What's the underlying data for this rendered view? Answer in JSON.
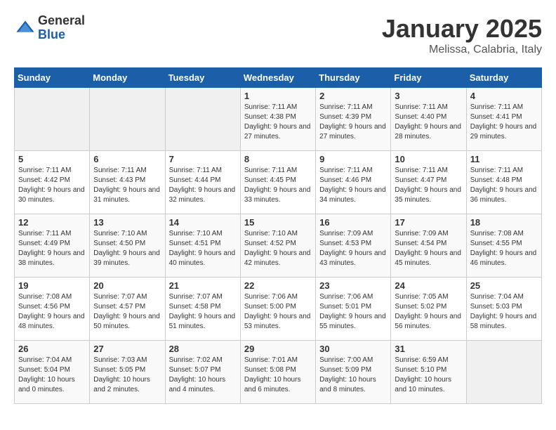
{
  "logo": {
    "general": "General",
    "blue": "Blue"
  },
  "header": {
    "title": "January 2025",
    "subtitle": "Melissa, Calabria, Italy"
  },
  "weekdays": [
    "Sunday",
    "Monday",
    "Tuesday",
    "Wednesday",
    "Thursday",
    "Friday",
    "Saturday"
  ],
  "weeks": [
    [
      {
        "day": "",
        "sunrise": "",
        "sunset": "",
        "daylight": ""
      },
      {
        "day": "",
        "sunrise": "",
        "sunset": "",
        "daylight": ""
      },
      {
        "day": "",
        "sunrise": "",
        "sunset": "",
        "daylight": ""
      },
      {
        "day": "1",
        "sunrise": "Sunrise: 7:11 AM",
        "sunset": "Sunset: 4:38 PM",
        "daylight": "Daylight: 9 hours and 27 minutes."
      },
      {
        "day": "2",
        "sunrise": "Sunrise: 7:11 AM",
        "sunset": "Sunset: 4:39 PM",
        "daylight": "Daylight: 9 hours and 27 minutes."
      },
      {
        "day": "3",
        "sunrise": "Sunrise: 7:11 AM",
        "sunset": "Sunset: 4:40 PM",
        "daylight": "Daylight: 9 hours and 28 minutes."
      },
      {
        "day": "4",
        "sunrise": "Sunrise: 7:11 AM",
        "sunset": "Sunset: 4:41 PM",
        "daylight": "Daylight: 9 hours and 29 minutes."
      }
    ],
    [
      {
        "day": "5",
        "sunrise": "Sunrise: 7:11 AM",
        "sunset": "Sunset: 4:42 PM",
        "daylight": "Daylight: 9 hours and 30 minutes."
      },
      {
        "day": "6",
        "sunrise": "Sunrise: 7:11 AM",
        "sunset": "Sunset: 4:43 PM",
        "daylight": "Daylight: 9 hours and 31 minutes."
      },
      {
        "day": "7",
        "sunrise": "Sunrise: 7:11 AM",
        "sunset": "Sunset: 4:44 PM",
        "daylight": "Daylight: 9 hours and 32 minutes."
      },
      {
        "day": "8",
        "sunrise": "Sunrise: 7:11 AM",
        "sunset": "Sunset: 4:45 PM",
        "daylight": "Daylight: 9 hours and 33 minutes."
      },
      {
        "day": "9",
        "sunrise": "Sunrise: 7:11 AM",
        "sunset": "Sunset: 4:46 PM",
        "daylight": "Daylight: 9 hours and 34 minutes."
      },
      {
        "day": "10",
        "sunrise": "Sunrise: 7:11 AM",
        "sunset": "Sunset: 4:47 PM",
        "daylight": "Daylight: 9 hours and 35 minutes."
      },
      {
        "day": "11",
        "sunrise": "Sunrise: 7:11 AM",
        "sunset": "Sunset: 4:48 PM",
        "daylight": "Daylight: 9 hours and 36 minutes."
      }
    ],
    [
      {
        "day": "12",
        "sunrise": "Sunrise: 7:11 AM",
        "sunset": "Sunset: 4:49 PM",
        "daylight": "Daylight: 9 hours and 38 minutes."
      },
      {
        "day": "13",
        "sunrise": "Sunrise: 7:10 AM",
        "sunset": "Sunset: 4:50 PM",
        "daylight": "Daylight: 9 hours and 39 minutes."
      },
      {
        "day": "14",
        "sunrise": "Sunrise: 7:10 AM",
        "sunset": "Sunset: 4:51 PM",
        "daylight": "Daylight: 9 hours and 40 minutes."
      },
      {
        "day": "15",
        "sunrise": "Sunrise: 7:10 AM",
        "sunset": "Sunset: 4:52 PM",
        "daylight": "Daylight: 9 hours and 42 minutes."
      },
      {
        "day": "16",
        "sunrise": "Sunrise: 7:09 AM",
        "sunset": "Sunset: 4:53 PM",
        "daylight": "Daylight: 9 hours and 43 minutes."
      },
      {
        "day": "17",
        "sunrise": "Sunrise: 7:09 AM",
        "sunset": "Sunset: 4:54 PM",
        "daylight": "Daylight: 9 hours and 45 minutes."
      },
      {
        "day": "18",
        "sunrise": "Sunrise: 7:08 AM",
        "sunset": "Sunset: 4:55 PM",
        "daylight": "Daylight: 9 hours and 46 minutes."
      }
    ],
    [
      {
        "day": "19",
        "sunrise": "Sunrise: 7:08 AM",
        "sunset": "Sunset: 4:56 PM",
        "daylight": "Daylight: 9 hours and 48 minutes."
      },
      {
        "day": "20",
        "sunrise": "Sunrise: 7:07 AM",
        "sunset": "Sunset: 4:57 PM",
        "daylight": "Daylight: 9 hours and 50 minutes."
      },
      {
        "day": "21",
        "sunrise": "Sunrise: 7:07 AM",
        "sunset": "Sunset: 4:58 PM",
        "daylight": "Daylight: 9 hours and 51 minutes."
      },
      {
        "day": "22",
        "sunrise": "Sunrise: 7:06 AM",
        "sunset": "Sunset: 5:00 PM",
        "daylight": "Daylight: 9 hours and 53 minutes."
      },
      {
        "day": "23",
        "sunrise": "Sunrise: 7:06 AM",
        "sunset": "Sunset: 5:01 PM",
        "daylight": "Daylight: 9 hours and 55 minutes."
      },
      {
        "day": "24",
        "sunrise": "Sunrise: 7:05 AM",
        "sunset": "Sunset: 5:02 PM",
        "daylight": "Daylight: 9 hours and 56 minutes."
      },
      {
        "day": "25",
        "sunrise": "Sunrise: 7:04 AM",
        "sunset": "Sunset: 5:03 PM",
        "daylight": "Daylight: 9 hours and 58 minutes."
      }
    ],
    [
      {
        "day": "26",
        "sunrise": "Sunrise: 7:04 AM",
        "sunset": "Sunset: 5:04 PM",
        "daylight": "Daylight: 10 hours and 0 minutes."
      },
      {
        "day": "27",
        "sunrise": "Sunrise: 7:03 AM",
        "sunset": "Sunset: 5:05 PM",
        "daylight": "Daylight: 10 hours and 2 minutes."
      },
      {
        "day": "28",
        "sunrise": "Sunrise: 7:02 AM",
        "sunset": "Sunset: 5:07 PM",
        "daylight": "Daylight: 10 hours and 4 minutes."
      },
      {
        "day": "29",
        "sunrise": "Sunrise: 7:01 AM",
        "sunset": "Sunset: 5:08 PM",
        "daylight": "Daylight: 10 hours and 6 minutes."
      },
      {
        "day": "30",
        "sunrise": "Sunrise: 7:00 AM",
        "sunset": "Sunset: 5:09 PM",
        "daylight": "Daylight: 10 hours and 8 minutes."
      },
      {
        "day": "31",
        "sunrise": "Sunrise: 6:59 AM",
        "sunset": "Sunset: 5:10 PM",
        "daylight": "Daylight: 10 hours and 10 minutes."
      },
      {
        "day": "",
        "sunrise": "",
        "sunset": "",
        "daylight": ""
      }
    ]
  ]
}
